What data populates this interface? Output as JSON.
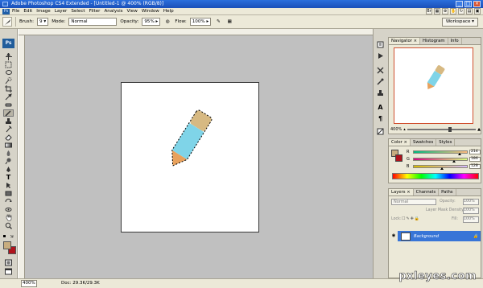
{
  "window": {
    "title": "Adobe Photoshop CS4 Extended - [Untitled-1 @ 400% (RGB/8)]"
  },
  "menu": [
    "File",
    "Edit",
    "Image",
    "Layer",
    "Select",
    "Filter",
    "Analysis",
    "View",
    "Window",
    "Help"
  ],
  "options": {
    "brush_label": "Brush:",
    "brush_size": "9",
    "mode_label": "Mode:",
    "mode_value": "Normal",
    "opacity_label": "Opacity:",
    "opacity_value": "95%",
    "flow_label": "Flow:",
    "flow_value": "100%",
    "workspace_label": "Workspace ▾"
  },
  "tools": [
    "move-tool",
    "marquee-tool",
    "lasso-tool",
    "quick-selection-tool",
    "crop-tool",
    "eyedropper-tool",
    "healing-brush-tool",
    "brush-tool",
    "clone-stamp-tool",
    "history-brush-tool",
    "eraser-tool",
    "gradient-tool",
    "blur-tool",
    "dodge-tool",
    "pen-tool",
    "type-tool",
    "path-selection-tool",
    "shape-tool",
    "3d-rotate-tool",
    "3d-orbit-tool",
    "hand-tool",
    "zoom-tool"
  ],
  "colors": {
    "foreground": "#c8ad7f",
    "background": "#b0131c",
    "pencil_body": "#7fd4e8",
    "pencil_eraser": "#d7b982",
    "pencil_tip": "#e8a15c",
    "layer_highlight": "#3875d7",
    "navigator_frame": "#d04f2f"
  },
  "navigator": {
    "tabs": [
      "Navigator ×",
      "Histogram",
      "Info"
    ],
    "zoom": "400%"
  },
  "color_panel": {
    "tabs": [
      "Color ×",
      "Swatches",
      "Styles"
    ],
    "r": {
      "label": "R",
      "value": "214",
      "level": 0.84
    },
    "g": {
      "label": "G",
      "value": "186",
      "level": 0.73
    },
    "b": {
      "label": "B",
      "value": "128",
      "level": 0.5
    }
  },
  "layers": {
    "tabs": [
      "Layers ×",
      "Channels",
      "Paths"
    ],
    "blend": "Normal",
    "opacity_label": "Opacity:",
    "opacity_value": "100%",
    "mask_density_label": "Layer Mask Density:",
    "mask_density_value": "100%",
    "lock_label": "Lock:",
    "fill_label": "Fill:",
    "fill_value": "100%",
    "rows": [
      {
        "name": "Background"
      }
    ]
  },
  "status": {
    "zoom": "400%",
    "doc_size": "Doc: 29.3K/29.3K",
    "brand": "pxleyes.com"
  }
}
